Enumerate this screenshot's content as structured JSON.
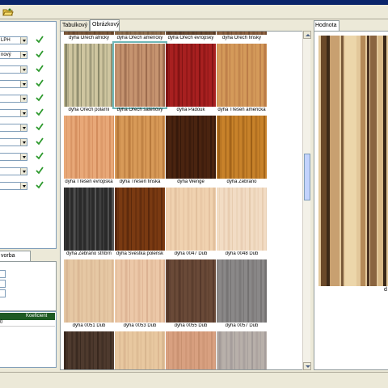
{
  "window": {
    "title_color": "#0a246a"
  },
  "toolbar": {
    "icon": "folder-open-icon"
  },
  "left_form": {
    "rows": [
      {
        "value": "LPH",
        "check": "checkmark-icon"
      },
      {
        "value": "nový",
        "check": "checkmark-icon"
      },
      {
        "value": "",
        "check": "checkmark-icon"
      },
      {
        "value": "",
        "check": "checkmark-icon"
      },
      {
        "value": "",
        "check": "checkmark-icon"
      },
      {
        "value": "",
        "check": "checkmark-icon"
      },
      {
        "value": "",
        "check": "checkmark-icon"
      },
      {
        "value": "",
        "check": "checkmark-icon"
      },
      {
        "value": "",
        "check": "checkmark-icon"
      },
      {
        "value": "",
        "check": "checkmark-icon"
      },
      {
        "value": "",
        "check": "checkmark-icon"
      }
    ]
  },
  "left_tab": {
    "label": "vorba"
  },
  "left_grid": {
    "header": "Koeficient",
    "row_value": "0"
  },
  "tabs": {
    "table": "Tabulkový",
    "images": "Obrázkový"
  },
  "right_tab": {
    "label": "Hodnota"
  },
  "gallery": {
    "items": [
      {
        "label": "dýha Ořech africký"
      },
      {
        "label": "dýha Ořech americký"
      },
      {
        "label": "dýha Ořech evropský"
      },
      {
        "label": "dýha Ořech finský"
      },
      {
        "label": "dýha Ořech polární"
      },
      {
        "label": "dýha Ořech saténový"
      },
      {
        "label": "dýha Padouk"
      },
      {
        "label": "dýha Třešeň americká"
      },
      {
        "label": "dýha Třešeň evropská"
      },
      {
        "label": "dýha Třešeň finská"
      },
      {
        "label": "dýha Wenge"
      },
      {
        "label": "dýha Zebrano"
      },
      {
        "label": "dýha Zebrano stříbrn"
      },
      {
        "label": "dýha Švestka polensk"
      },
      {
        "label": "dýha 0047 Dub"
      },
      {
        "label": "dýha 0048 Dub"
      },
      {
        "label": "dýha 0051 Dub"
      },
      {
        "label": "dýha 0053 Dub"
      },
      {
        "label": "dýha 0055 Dub"
      },
      {
        "label": "dýha 0057 Dub"
      },
      {
        "label": ""
      },
      {
        "label": ""
      },
      {
        "label": ""
      },
      {
        "label": ""
      }
    ],
    "selected_label": "dýha Ořech saténový",
    "selection_color": "#6fb7b7"
  },
  "preview": {
    "caption": "d"
  },
  "colors": {
    "grid_header": "#1e5a23",
    "check": "#2e9a2e"
  }
}
